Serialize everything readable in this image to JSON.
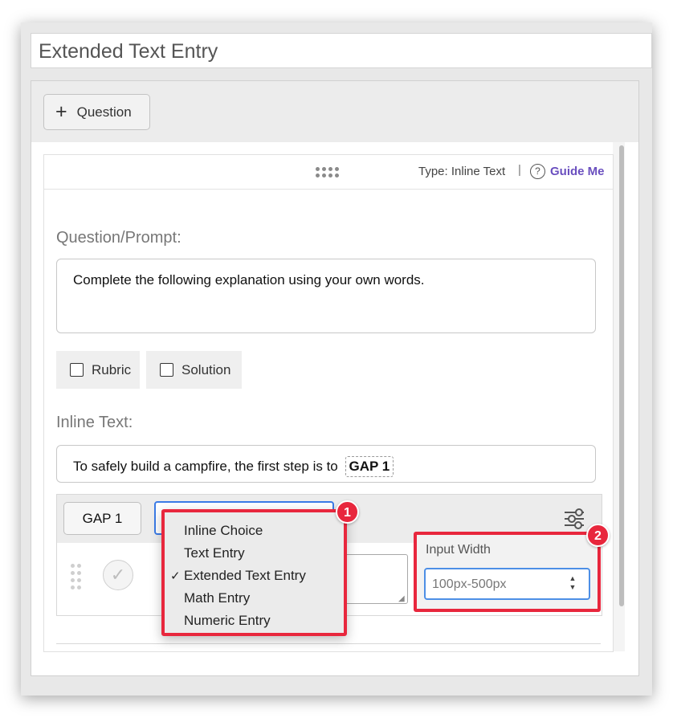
{
  "title": "Extended Text Entry",
  "toolbar": {
    "add_question_label": "Question"
  },
  "card": {
    "type_label": "Type: Inline Text",
    "separator": "|",
    "help_glyph": "?",
    "guide_label": "Guide Me"
  },
  "prompt": {
    "label": "Question/Prompt:",
    "text": "Complete the following explanation using your own words."
  },
  "options": {
    "rubric_label": "Rubric",
    "solution_label": "Solution"
  },
  "inline": {
    "label": "Inline Text:",
    "text": "To safely build a campfire, the first step is to",
    "gap_token": "GAP 1"
  },
  "gap": {
    "button_label": "GAP 1",
    "type_options": [
      "Inline Choice",
      "Text Entry",
      "Extended Text Entry",
      "Math Entry",
      "Numeric Entry"
    ],
    "selected_type": "Extended Text Entry",
    "check_mark": "✓"
  },
  "input_width": {
    "label": "Input Width",
    "value": "100px-500px"
  },
  "annotations": {
    "badge_1": "1",
    "badge_2": "2"
  },
  "colors": {
    "highlight": "#e8273d",
    "accent_link": "#6a4fbf",
    "focus_blue": "#3b7be6"
  }
}
